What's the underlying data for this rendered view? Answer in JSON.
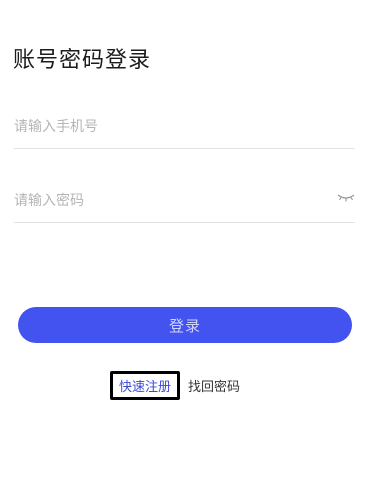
{
  "title": "账号密码登录",
  "phone_input": {
    "placeholder": "请输入手机号",
    "value": ""
  },
  "password_input": {
    "placeholder": "请输入密码",
    "value": "",
    "visibility_icon": "eye-closed-icon"
  },
  "login_button": {
    "label": "登录"
  },
  "links": {
    "register": "快速注册",
    "forgot_password": "找回密码"
  },
  "colors": {
    "primary": "#4353f0",
    "button_text": "#cfd4ff",
    "link": "#3a48d8",
    "placeholder": "#b5b5b5",
    "divider": "#e3e3e3"
  }
}
